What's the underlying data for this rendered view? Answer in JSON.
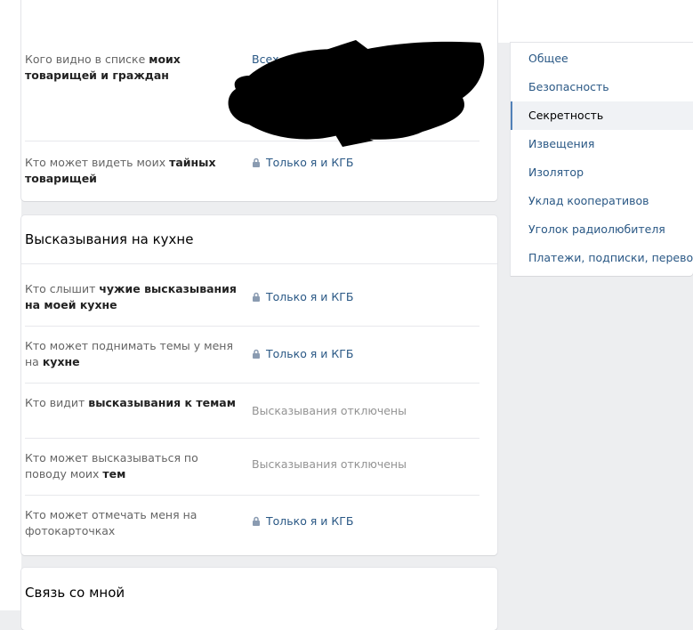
{
  "privacy_top": {
    "rows": [
      {
        "label_pre": "Кого видно в списке ",
        "label_bold": "моих товарищей и граждан",
        "label_post": "",
        "value": "Всех, кроме: Д..."
      },
      {
        "label_pre": "Кто может видеть моих ",
        "label_bold": "тайных товарищей",
        "label_post": "",
        "value": "Только я и КГБ"
      }
    ]
  },
  "kitchen": {
    "title": "Высказывания на кухне",
    "rows": [
      {
        "label_pre": "Кто слышит ",
        "label_bold": "чужие высказывания на моей кухне",
        "label_post": "",
        "value": "Только я и КГБ"
      },
      {
        "label_pre": "Кто может поднимать темы у меня на ",
        "label_bold": "кухне",
        "label_post": "",
        "value": "Только я и КГБ"
      },
      {
        "label_pre": "Кто видит ",
        "label_bold": "высказывания к темам",
        "label_post": "",
        "value": "Высказывания отключены"
      },
      {
        "label_pre": "Кто может высказываться по поводу моих ",
        "label_bold": "тем",
        "label_post": "",
        "value": "Высказывания отключены"
      },
      {
        "label_pre": "Кто может отмечать меня на фотокарточках",
        "label_bold": "",
        "label_post": "",
        "value": "Только я и КГБ"
      }
    ]
  },
  "contact": {
    "title": "Связь со мной"
  },
  "menu": {
    "items": [
      {
        "label": "Общее"
      },
      {
        "label": "Безопасность"
      },
      {
        "label": "Секретность"
      },
      {
        "label": "Извещения"
      },
      {
        "label": "Изолятор"
      },
      {
        "label": "Уклад кооперативов"
      },
      {
        "label": "Уголок радиолюбителя"
      },
      {
        "label": "Платежи, подписки, переводы"
      }
    ],
    "active_index": 2
  },
  "icons": {
    "lock": "lock-icon"
  },
  "colors": {
    "link": "#2a5885",
    "muted": "#939393",
    "accent": "#5181b8",
    "background": "#edeef0"
  }
}
